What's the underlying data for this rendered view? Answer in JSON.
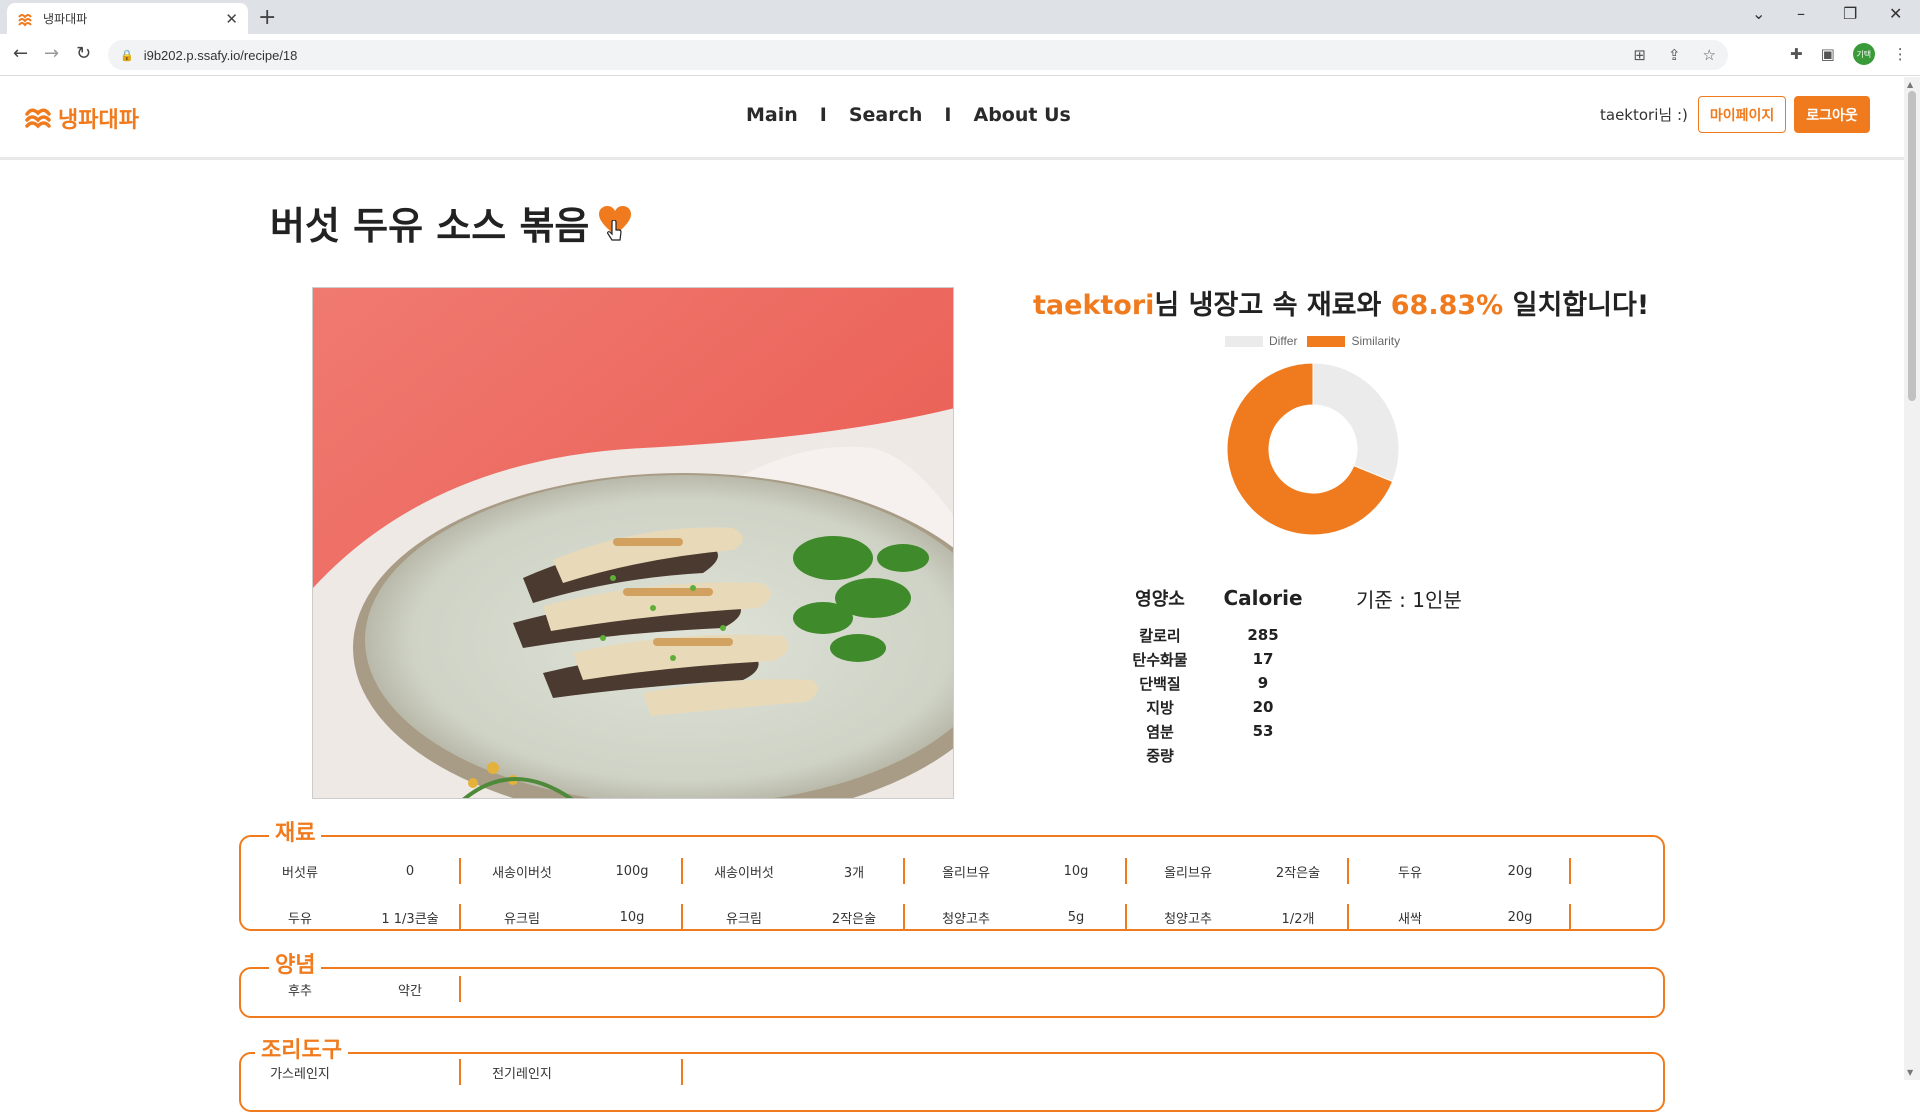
{
  "browser": {
    "tab_title": "냉파대파",
    "url": "i9b202.p.ssafy.io/recipe/18",
    "profile_initials": "기택"
  },
  "header": {
    "logo_text": "냉파대파",
    "nav": [
      "Main",
      "Search",
      "About Us"
    ],
    "nav_separator": "I",
    "user_greeting": "taektori님 :)",
    "mypage_label": "마이페이지",
    "logout_label": "로그아웃"
  },
  "recipe": {
    "title": "버섯 두유 소스 볶음",
    "liked": true
  },
  "match": {
    "user": "taektori",
    "text_mid": "님 냉장고 속 재료와 ",
    "percent": "68.83%",
    "text_end": " 일치합니다!"
  },
  "chart_data": {
    "type": "pie",
    "donut": true,
    "legend": [
      "Differ",
      "Similarity"
    ],
    "values": [
      31.17,
      68.83
    ],
    "colors": [
      "#ebebeb",
      "#f07b1e"
    ]
  },
  "nutrition": {
    "col_nutrient": "영양소",
    "col_calorie": "Calorie",
    "basis": "기준 : 1인분",
    "rows": [
      {
        "name": "칼로리",
        "value": "285"
      },
      {
        "name": "탄수화물",
        "value": "17"
      },
      {
        "name": "단백질",
        "value": "9"
      },
      {
        "name": "지방",
        "value": "20"
      },
      {
        "name": "염분",
        "value": "53"
      },
      {
        "name": "중량",
        "value": ""
      }
    ]
  },
  "ingredients": {
    "label": "재료",
    "rows": [
      [
        [
          "버섯류",
          "0"
        ],
        [
          "새송이버섯",
          "100g"
        ],
        [
          "새송이버섯",
          "3개"
        ],
        [
          "올리브유",
          "10g"
        ],
        [
          "올리브유",
          "2작은술"
        ],
        [
          "두유",
          "20g"
        ]
      ],
      [
        [
          "두유",
          "1 1/3큰술"
        ],
        [
          "유크림",
          "10g"
        ],
        [
          "유크림",
          "2작은술"
        ],
        [
          "청양고추",
          "5g"
        ],
        [
          "청양고추",
          "1/2개"
        ],
        [
          "새싹",
          "20g"
        ]
      ]
    ]
  },
  "seasoning": {
    "label": "양념",
    "rows": [
      [
        [
          "후추",
          "약간"
        ]
      ]
    ]
  },
  "tools": {
    "label": "조리도구",
    "rows": [
      [
        [
          "가스레인지",
          ""
        ],
        [
          "전기레인지",
          ""
        ]
      ]
    ]
  },
  "colors": {
    "accent": "#f07b1e",
    "differ": "#ebebeb"
  }
}
